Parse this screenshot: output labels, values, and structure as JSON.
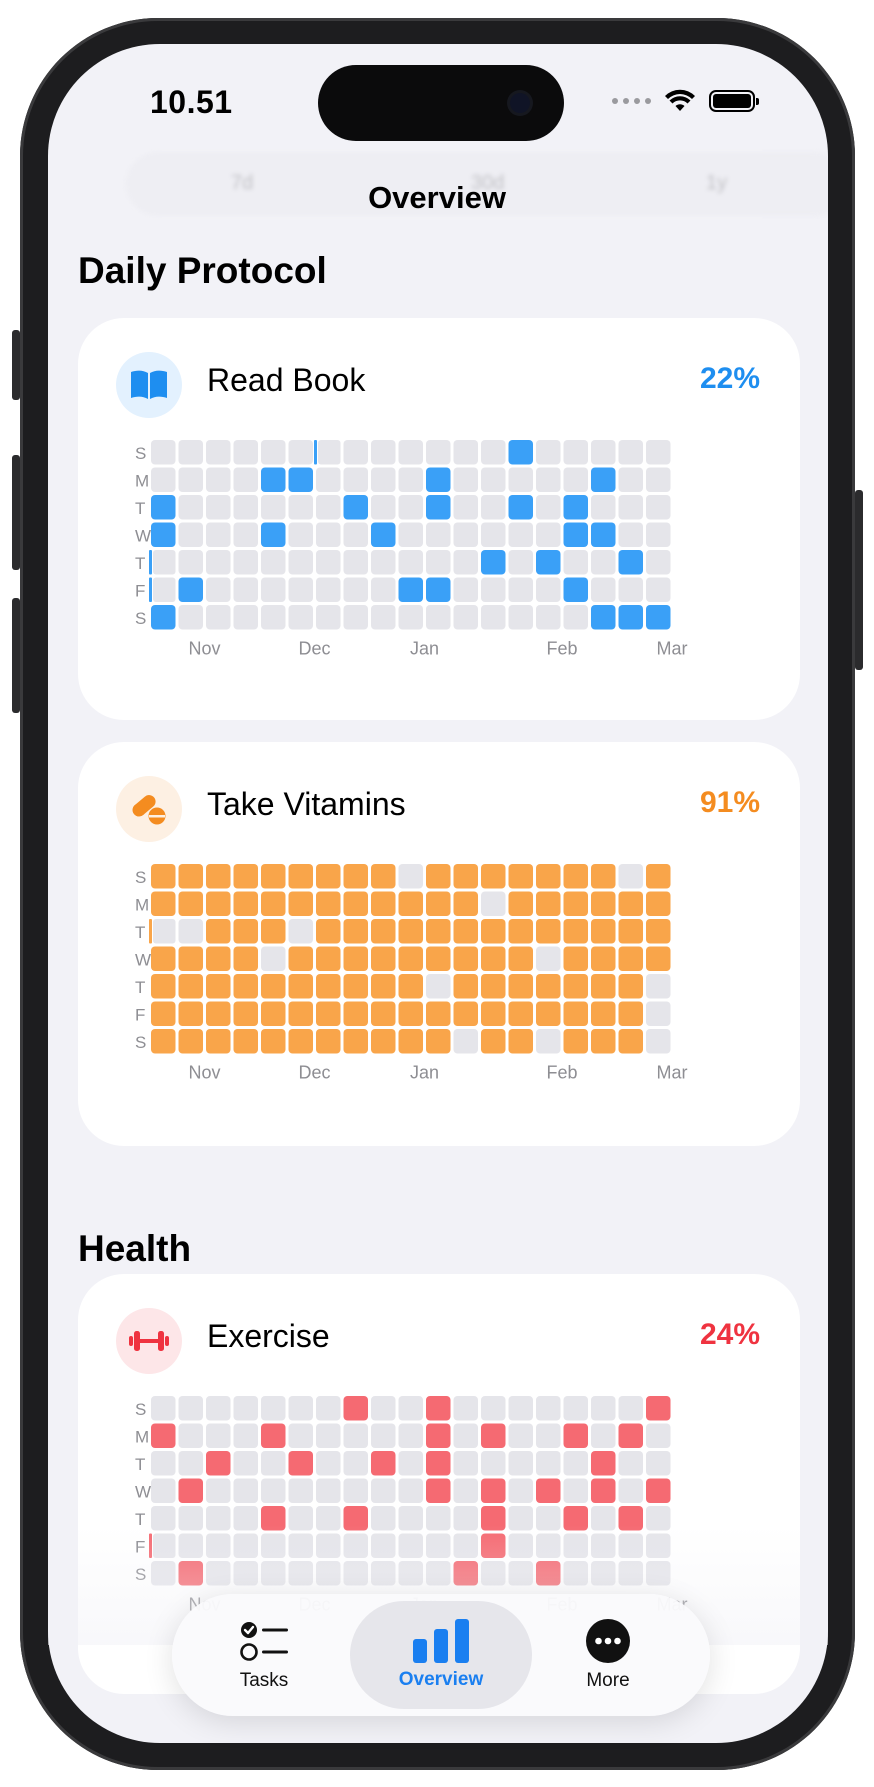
{
  "status_bar": {
    "time": "10.51"
  },
  "segmented_ghost": [
    "7d",
    "30d",
    "1y"
  ],
  "nav": {
    "title": "Overview"
  },
  "colors": {
    "blue": "#3aa0f7",
    "orange": "#f9a54a",
    "red": "#f56a72",
    "empty": "#e5e5ea",
    "blue_text": "#1e8ef0",
    "orange_text": "#f48c20",
    "red_text": "#ef3340",
    "tab_blue": "#1a7ff0"
  },
  "sections": [
    {
      "title": "Daily Protocol",
      "habits": [
        {
          "name": "Read Book",
          "percent": "22%",
          "icon": "book-icon",
          "color": "blue",
          "day_labels": [
            "S",
            "M",
            "T",
            "W",
            "T",
            "F",
            "S"
          ],
          "month_labels": [
            "Nov",
            "Dec",
            "Jan",
            "Feb",
            "Mar"
          ],
          "rows": [
            "0003002000000100000",
            "0000110000100000100",
            "1000000100100101000",
            "1000100010000001100",
            "2000000000001010010",
            "2100000001100001000",
            "1000000000000000111"
          ]
        },
        {
          "name": "Take Vitamins",
          "percent": "91%",
          "icon": "pills-icon",
          "color": "orange",
          "day_labels": [
            "S",
            "M",
            "T",
            "W",
            "T",
            "F",
            "S"
          ],
          "month_labels": [
            "Nov",
            "Dec",
            "Jan",
            "Feb",
            "Mar"
          ],
          "rows": [
            "1111111110111111101",
            "1111111111110111111",
            "2011101111111111111",
            "1111011111111101111",
            "1111111111011111110",
            "1111111111111111110",
            "1111111111101101110"
          ]
        }
      ]
    },
    {
      "title": "Health",
      "habits": [
        {
          "name": "Exercise",
          "percent": "24%",
          "icon": "dumbbell-icon",
          "color": "red",
          "day_labels": [
            "S",
            "M",
            "T",
            "W",
            "T",
            "F",
            "S"
          ],
          "month_labels": [
            "Nov",
            "Dec",
            "Jan",
            "Feb",
            "Mar"
          ],
          "rows": [
            "0000000100100000001",
            "1000100000101001010",
            "0010010010100000100",
            "0100000000101010101",
            "0000100100001001010",
            "2000000000001000000",
            "0100000000010010000"
          ]
        }
      ]
    }
  ],
  "tabs": [
    {
      "label": "Tasks",
      "icon": "tasks-list-icon",
      "active": false
    },
    {
      "label": "Overview",
      "icon": "bar-chart-icon",
      "active": true
    },
    {
      "label": "More",
      "icon": "more-ellipsis-icon",
      "active": false
    }
  ]
}
